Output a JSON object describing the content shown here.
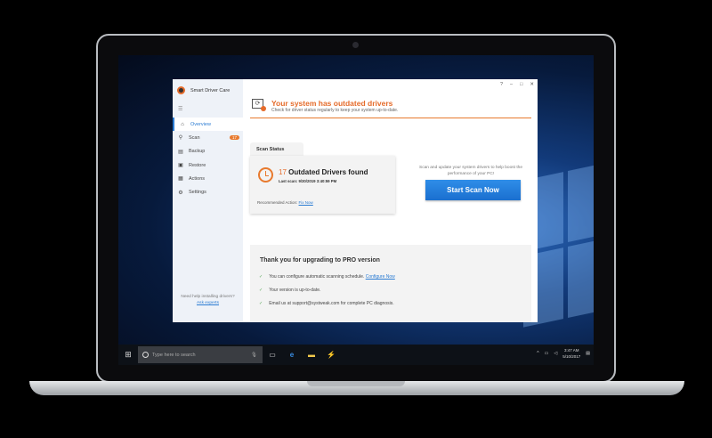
{
  "app": {
    "name": "Smart Driver Care",
    "window_controls": [
      "?",
      "–",
      "□",
      "✕"
    ]
  },
  "sidebar": {
    "items": [
      {
        "label": "Overview",
        "icon": "home-icon",
        "active": true
      },
      {
        "label": "Scan",
        "icon": "search-icon",
        "badge": "17"
      },
      {
        "label": "Backup",
        "icon": "backup-icon"
      },
      {
        "label": "Restore",
        "icon": "restore-icon"
      },
      {
        "label": "Actions",
        "icon": "grid-icon"
      },
      {
        "label": "Settings",
        "icon": "gear-icon"
      }
    ],
    "help_text": "Need help installing drivers?",
    "help_link": "Ask experts"
  },
  "header": {
    "title": "Your system has outdated drivers",
    "subtitle": "Check for driver status regularly to keep your system up-to-date."
  },
  "scan_status": {
    "tab": "Scan Status",
    "count": "17",
    "found_text": "Outdated Drivers found",
    "last_scan": "Last scan: 9/30/2019 3:40:59 PM",
    "recommended_label": "Recommended Action:",
    "recommended_link": "Fix Now"
  },
  "cta": {
    "text": "Scan and update your system drivers to help boost the performance of your PC!",
    "button": "Start Scan Now"
  },
  "pro": {
    "title": "Thank you for upgrading to PRO version",
    "lines": [
      {
        "text": "You can configure automatic scanning schedule.",
        "link": "Configure Now"
      },
      {
        "text": "Your version is up-to-date."
      },
      {
        "text": "Email us at support@systweak.com for complete PC diagnosis."
      }
    ]
  },
  "taskbar": {
    "search_placeholder": "Type here to search",
    "time": "3:47 AM",
    "date": "5/10/2017"
  },
  "colors": {
    "accent": "#e56b2a",
    "primary": "#2b7cd3"
  }
}
